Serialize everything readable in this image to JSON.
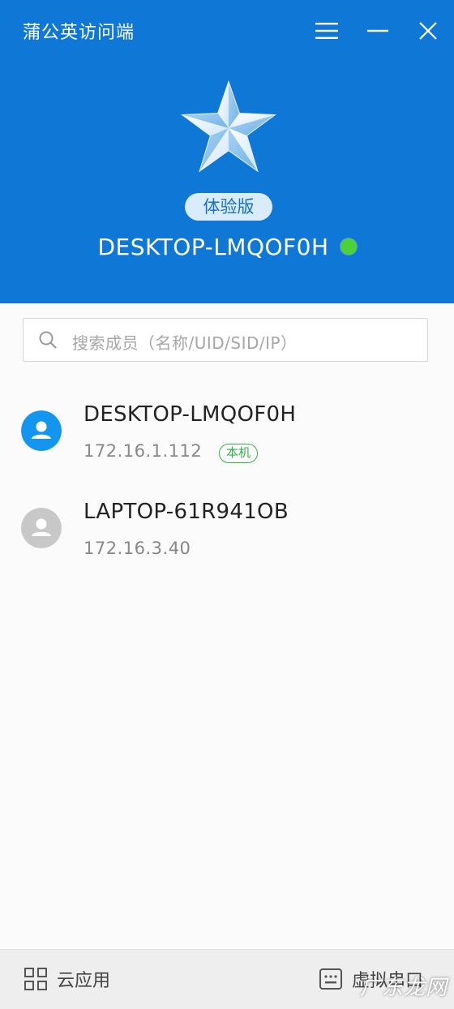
{
  "window": {
    "title": "蒲公英访问端",
    "menu_icon": "hamburger-menu-icon",
    "minimize_icon": "minimize-icon",
    "close_icon": "close-icon"
  },
  "header": {
    "logo_icon": "star-logo-icon",
    "edition_badge": "体验版",
    "device_name": "DESKTOP-LMQOF0H",
    "status": "online",
    "status_color": "#4cd137",
    "background_color": "#0f78d6"
  },
  "search": {
    "placeholder": "搜索成员（名称/UID/SID/IP）",
    "icon": "search-icon"
  },
  "members": [
    {
      "name": "DESKTOP-LMQOF0H",
      "ip": "172.16.1.112",
      "badge": "本机",
      "avatar_color": "#1296f0",
      "status": "online"
    },
    {
      "name": "LAPTOP-61R941OB",
      "ip": "172.16.3.40",
      "avatar_color": "#c8c8c8",
      "status": "offline"
    }
  ],
  "footer": {
    "left_label": "云应用",
    "left_icon": "grid-apps-icon",
    "right_label": "虚拟串口",
    "right_icon": "serial-port-icon"
  },
  "watermark": "广东龙网"
}
